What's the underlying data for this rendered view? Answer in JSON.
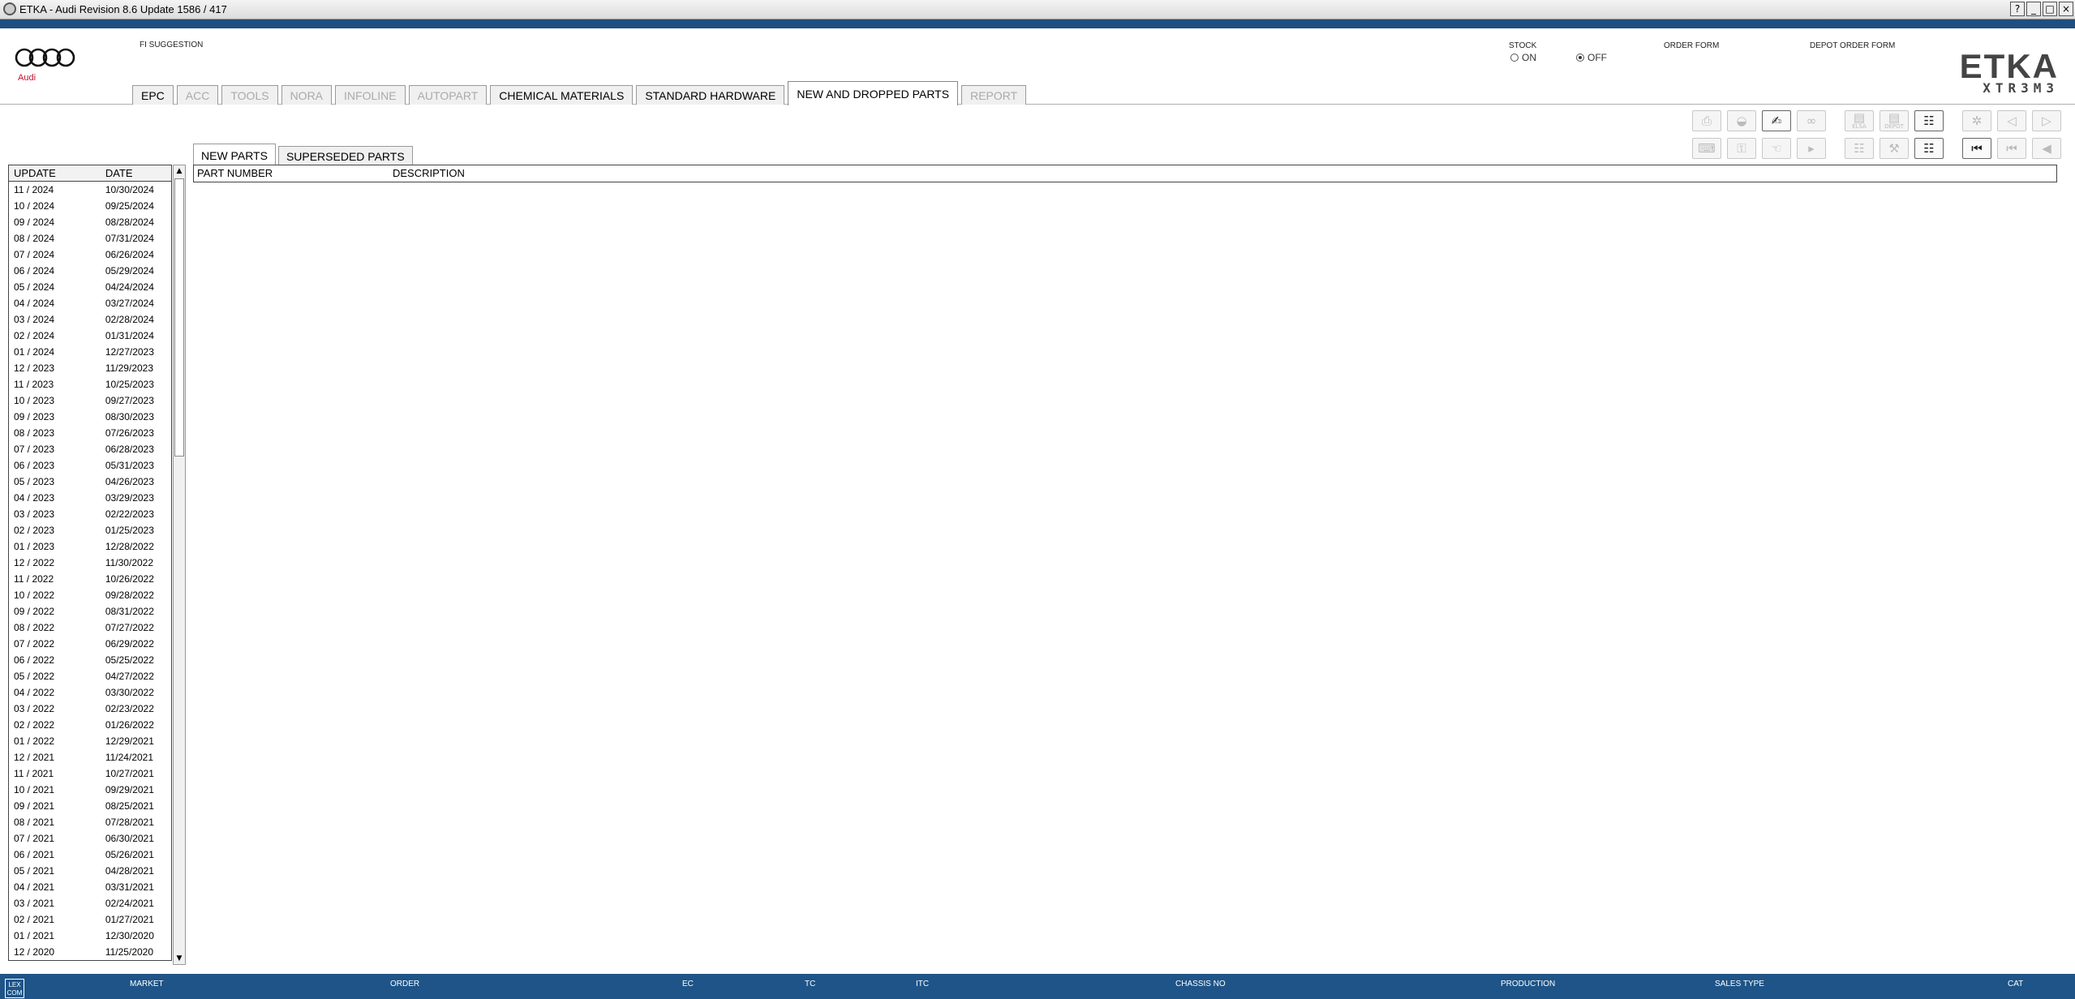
{
  "window": {
    "title": "ETKA - Audi Revision 8.6 Update 1586 / 417",
    "controls": [
      "?",
      "_",
      "□",
      "×"
    ]
  },
  "header": {
    "brand_name": "Audi",
    "fi_suggestion": "FI SUGGESTION",
    "stock_label": "STOCK",
    "stock_on": "ON",
    "stock_off": "OFF",
    "stock_selected": "OFF",
    "order_form": "ORDER FORM",
    "depot_order_form": "DEPOT ORDER FORM",
    "etka_logo": "ETKA",
    "etka_sub": "XTR3M3"
  },
  "main_tabs": [
    {
      "label": "EPC",
      "state": "normal"
    },
    {
      "label": "ACC",
      "state": "disabled"
    },
    {
      "label": "TOOLS",
      "state": "disabled"
    },
    {
      "label": "NORA",
      "state": "disabled"
    },
    {
      "label": "INFOLINE",
      "state": "disabled"
    },
    {
      "label": "AUTOPART",
      "state": "disabled"
    },
    {
      "label": "CHEMICAL MATERIALS",
      "state": "normal"
    },
    {
      "label": "STANDARD HARDWARE",
      "state": "normal"
    },
    {
      "label": "NEW AND DROPPED PARTS",
      "state": "active"
    },
    {
      "label": "REPORT",
      "state": "disabled"
    }
  ],
  "toolbar": {
    "row1": [
      {
        "name": "print-icon",
        "glyph": "⎙",
        "enabled": false
      },
      {
        "name": "stamp-icon",
        "glyph": "◒",
        "enabled": false
      },
      {
        "name": "handshake-icon",
        "glyph": "✍",
        "enabled": true
      },
      {
        "name": "glasses-icon",
        "glyph": "∞",
        "enabled": false
      },
      {
        "name": "elsa-icon",
        "glyph": "▤",
        "enabled": false,
        "caption": "ELSA"
      },
      {
        "name": "depot-icon",
        "glyph": "▤",
        "enabled": false,
        "caption": "DEPOT"
      },
      {
        "name": "cart-icon",
        "glyph": "☷",
        "enabled": true
      },
      {
        "name": "pin-icon",
        "glyph": "✲",
        "enabled": false
      },
      {
        "name": "page-back-icon",
        "glyph": "◁",
        "enabled": false
      },
      {
        "name": "page-forward-icon",
        "glyph": "▷",
        "enabled": false
      }
    ],
    "row2": [
      {
        "name": "keyboard-icon",
        "glyph": "⌨",
        "enabled": false
      },
      {
        "name": "key-icon",
        "glyph": "⚿",
        "enabled": false
      },
      {
        "name": "hand-icon",
        "glyph": "☜",
        "enabled": false
      },
      {
        "name": "expand-icon",
        "glyph": "▸",
        "enabled": false
      },
      {
        "name": "calculator-icon",
        "glyph": "☷",
        "enabled": false
      },
      {
        "name": "chassis-icon",
        "glyph": "⚒",
        "enabled": false
      },
      {
        "name": "cart-add-icon",
        "glyph": "☷",
        "enabled": true
      },
      {
        "name": "first-page-icon",
        "glyph": "⏮",
        "enabled": true
      },
      {
        "name": "previous-icon",
        "glyph": "⏮",
        "enabled": false
      },
      {
        "name": "back-icon",
        "glyph": "◀",
        "enabled": false
      }
    ]
  },
  "update_table": {
    "headers": [
      "UPDATE",
      "DATE"
    ],
    "rows": [
      [
        "11 / 2024",
        "10/30/2024"
      ],
      [
        "10 / 2024",
        "09/25/2024"
      ],
      [
        "09 / 2024",
        "08/28/2024"
      ],
      [
        "08 / 2024",
        "07/31/2024"
      ],
      [
        "07 / 2024",
        "06/26/2024"
      ],
      [
        "06 / 2024",
        "05/29/2024"
      ],
      [
        "05 / 2024",
        "04/24/2024"
      ],
      [
        "04 / 2024",
        "03/27/2024"
      ],
      [
        "03 / 2024",
        "02/28/2024"
      ],
      [
        "02 / 2024",
        "01/31/2024"
      ],
      [
        "01 / 2024",
        "12/27/2023"
      ],
      [
        "12 / 2023",
        "11/29/2023"
      ],
      [
        "11 / 2023",
        "10/25/2023"
      ],
      [
        "10 / 2023",
        "09/27/2023"
      ],
      [
        "09 / 2023",
        "08/30/2023"
      ],
      [
        "08 / 2023",
        "07/26/2023"
      ],
      [
        "07 / 2023",
        "06/28/2023"
      ],
      [
        "06 / 2023",
        "05/31/2023"
      ],
      [
        "05 / 2023",
        "04/26/2023"
      ],
      [
        "04 / 2023",
        "03/29/2023"
      ],
      [
        "03 / 2023",
        "02/22/2023"
      ],
      [
        "02 / 2023",
        "01/25/2023"
      ],
      [
        "01 / 2023",
        "12/28/2022"
      ],
      [
        "12 / 2022",
        "11/30/2022"
      ],
      [
        "11 / 2022",
        "10/26/2022"
      ],
      [
        "10 / 2022",
        "09/28/2022"
      ],
      [
        "09 / 2022",
        "08/31/2022"
      ],
      [
        "08 / 2022",
        "07/27/2022"
      ],
      [
        "07 / 2022",
        "06/29/2022"
      ],
      [
        "06 / 2022",
        "05/25/2022"
      ],
      [
        "05 / 2022",
        "04/27/2022"
      ],
      [
        "04 / 2022",
        "03/30/2022"
      ],
      [
        "03 / 2022",
        "02/23/2022"
      ],
      [
        "02 / 2022",
        "01/26/2022"
      ],
      [
        "01 / 2022",
        "12/29/2021"
      ],
      [
        "12 / 2021",
        "11/24/2021"
      ],
      [
        "11 / 2021",
        "10/27/2021"
      ],
      [
        "10 / 2021",
        "09/29/2021"
      ],
      [
        "09 / 2021",
        "08/25/2021"
      ],
      [
        "08 / 2021",
        "07/28/2021"
      ],
      [
        "07 / 2021",
        "06/30/2021"
      ],
      [
        "06 / 2021",
        "05/26/2021"
      ],
      [
        "05 / 2021",
        "04/28/2021"
      ],
      [
        "04 / 2021",
        "03/31/2021"
      ],
      [
        "03 / 2021",
        "02/24/2021"
      ],
      [
        "02 / 2021",
        "01/27/2021"
      ],
      [
        "01 / 2021",
        "12/30/2020"
      ],
      [
        "12 / 2020",
        "11/25/2020"
      ]
    ]
  },
  "sub_tabs": [
    {
      "label": "NEW PARTS",
      "active": true
    },
    {
      "label": "SUPERSEDED PARTS",
      "active": false
    }
  ],
  "parts_table": {
    "headers": [
      "PART NUMBER",
      "DESCRIPTION"
    ]
  },
  "statusbar": {
    "lex_badge": "LEX COM",
    "labels": [
      "MARKET",
      "ORDER",
      "EC",
      "TC",
      "ITC",
      "CHASSIS NO",
      "PRODUCTION",
      "SALES TYPE",
      "CAT"
    ]
  }
}
